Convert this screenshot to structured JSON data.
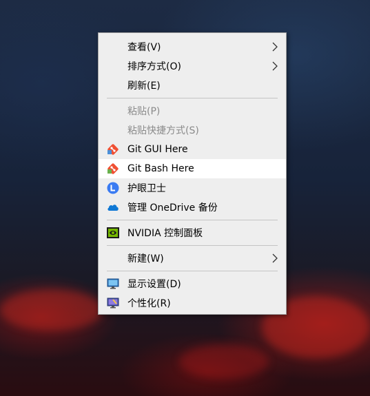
{
  "context_menu": {
    "items": [
      {
        "label": "查看(V)",
        "has_submenu": true
      },
      {
        "label": "排序方式(O)",
        "has_submenu": true
      },
      {
        "label": "刷新(E)"
      },
      {
        "label": "粘贴(P)",
        "disabled": true
      },
      {
        "label": "粘贴快捷方式(S)",
        "disabled": true
      },
      {
        "label": "Git GUI Here",
        "icon": "git-gui-icon"
      },
      {
        "label": "Git Bash Here",
        "icon": "git-bash-icon",
        "highlighted": true
      },
      {
        "label": "护眼卫士",
        "icon": "eye-guard-icon"
      },
      {
        "label": "管理 OneDrive 备份",
        "icon": "onedrive-icon"
      },
      {
        "label": "NVIDIA 控制面板",
        "icon": "nvidia-icon"
      },
      {
        "label": "新建(W)",
        "has_submenu": true
      },
      {
        "label": "显示设置(D)",
        "icon": "display-settings-icon"
      },
      {
        "label": "个性化(R)",
        "icon": "personalize-icon"
      }
    ]
  },
  "colors": {
    "menu_bg": "#eeeeee",
    "highlight_bg": "#ffffff",
    "disabled_text": "#8a8a8a",
    "git_orange": "#f05033",
    "nvidia_green": "#76b900",
    "onedrive_blue": "#0f78d4",
    "eye_guard_blue": "#3a7bf2"
  }
}
